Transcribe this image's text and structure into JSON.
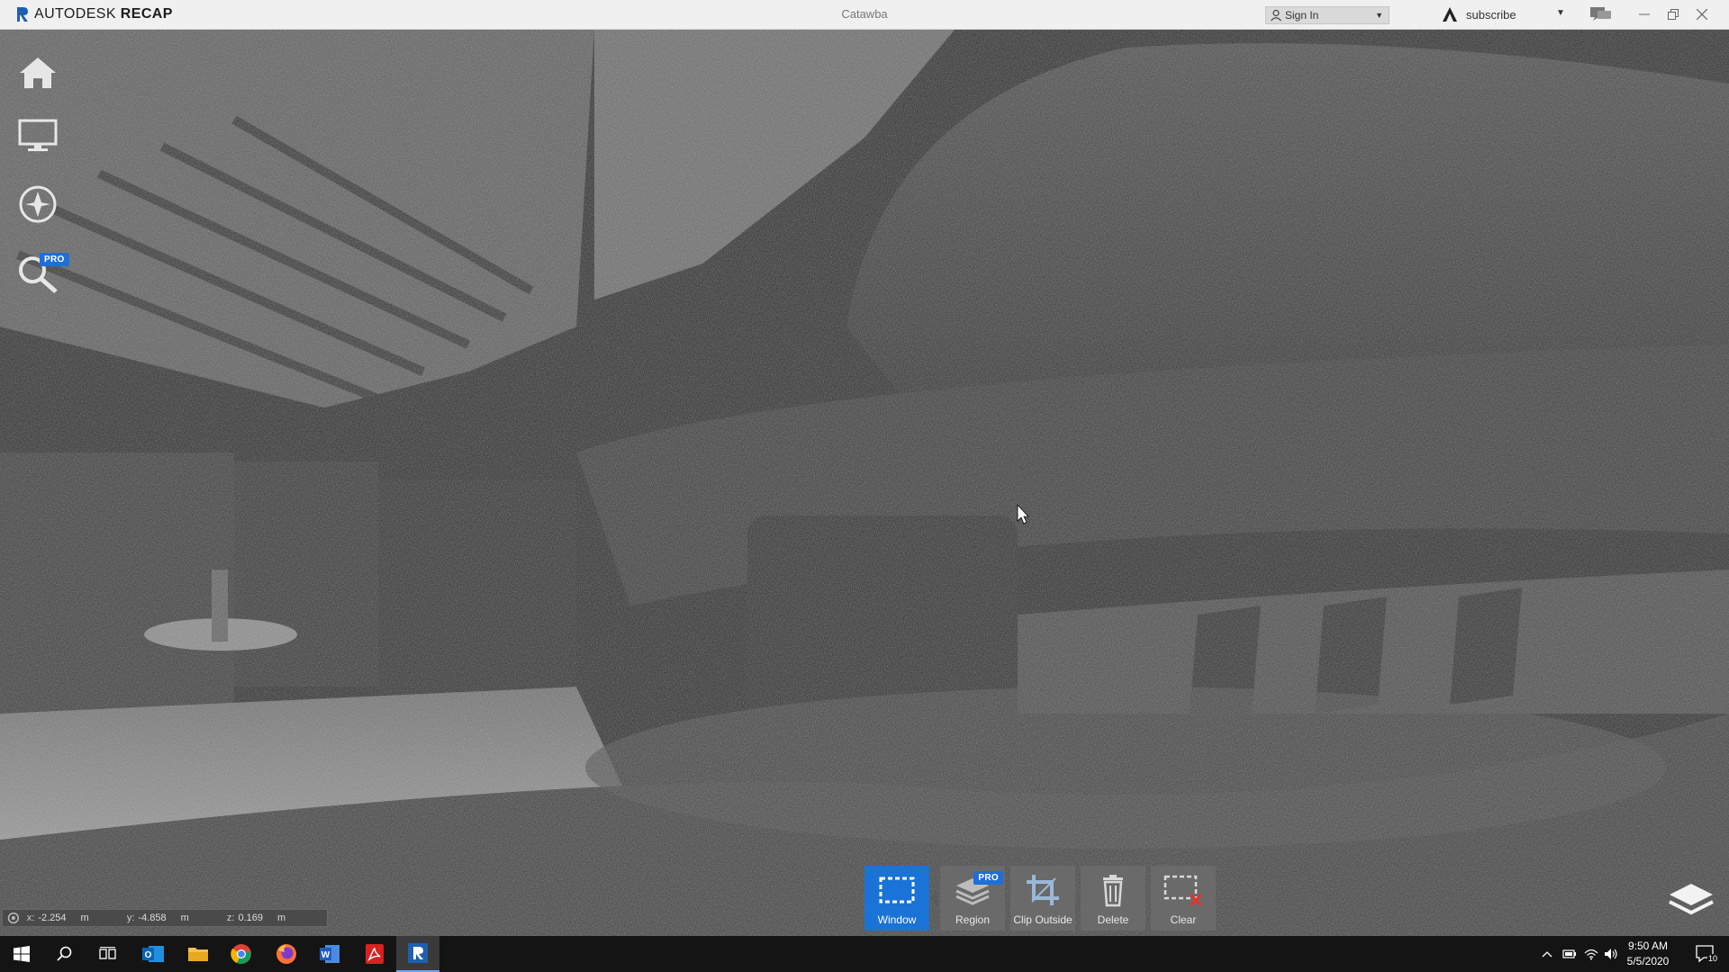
{
  "app": {
    "brand_prefix": "AUTODESK",
    "brand_suffix": "RECAP",
    "document_title": "Catawba",
    "sign_in_label": "Sign In",
    "subscribe_label": "subscribe"
  },
  "left_toolbar": [
    {
      "name": "home",
      "icon": "home-icon"
    },
    {
      "name": "display",
      "icon": "monitor-icon"
    },
    {
      "name": "navigation",
      "icon": "compass-icon"
    },
    {
      "name": "search",
      "icon": "magnifier-icon",
      "badge": "PRO"
    }
  ],
  "coordinates": {
    "x_label": "x:",
    "x_value": "-2.254",
    "x_unit": "m",
    "y_label": "y:",
    "y_value": "-4.858",
    "y_unit": "m",
    "z_label": "z:",
    "z_value": "0.169",
    "z_unit": "m"
  },
  "selection_toolbar": {
    "window_label": "Window",
    "region_label": "Region",
    "region_badge": "PRO",
    "clip_outside_label": "Clip Outside",
    "delete_label": "Delete",
    "clear_label": "Clear",
    "active": "Window"
  },
  "taskbar": {
    "apps": [
      "start",
      "search",
      "task-view",
      "outlook",
      "file-explorer",
      "chrome",
      "firefox",
      "word",
      "acrobat",
      "recap"
    ],
    "active_app": "recap",
    "time": "9:50 AM",
    "date": "5/5/2020",
    "notification_count": "10"
  },
  "colors": {
    "accent": "#1a73d6",
    "titlebar": "#f0f0f0",
    "toolbar_button": "#6a6a6a",
    "taskbar": "#141414"
  }
}
